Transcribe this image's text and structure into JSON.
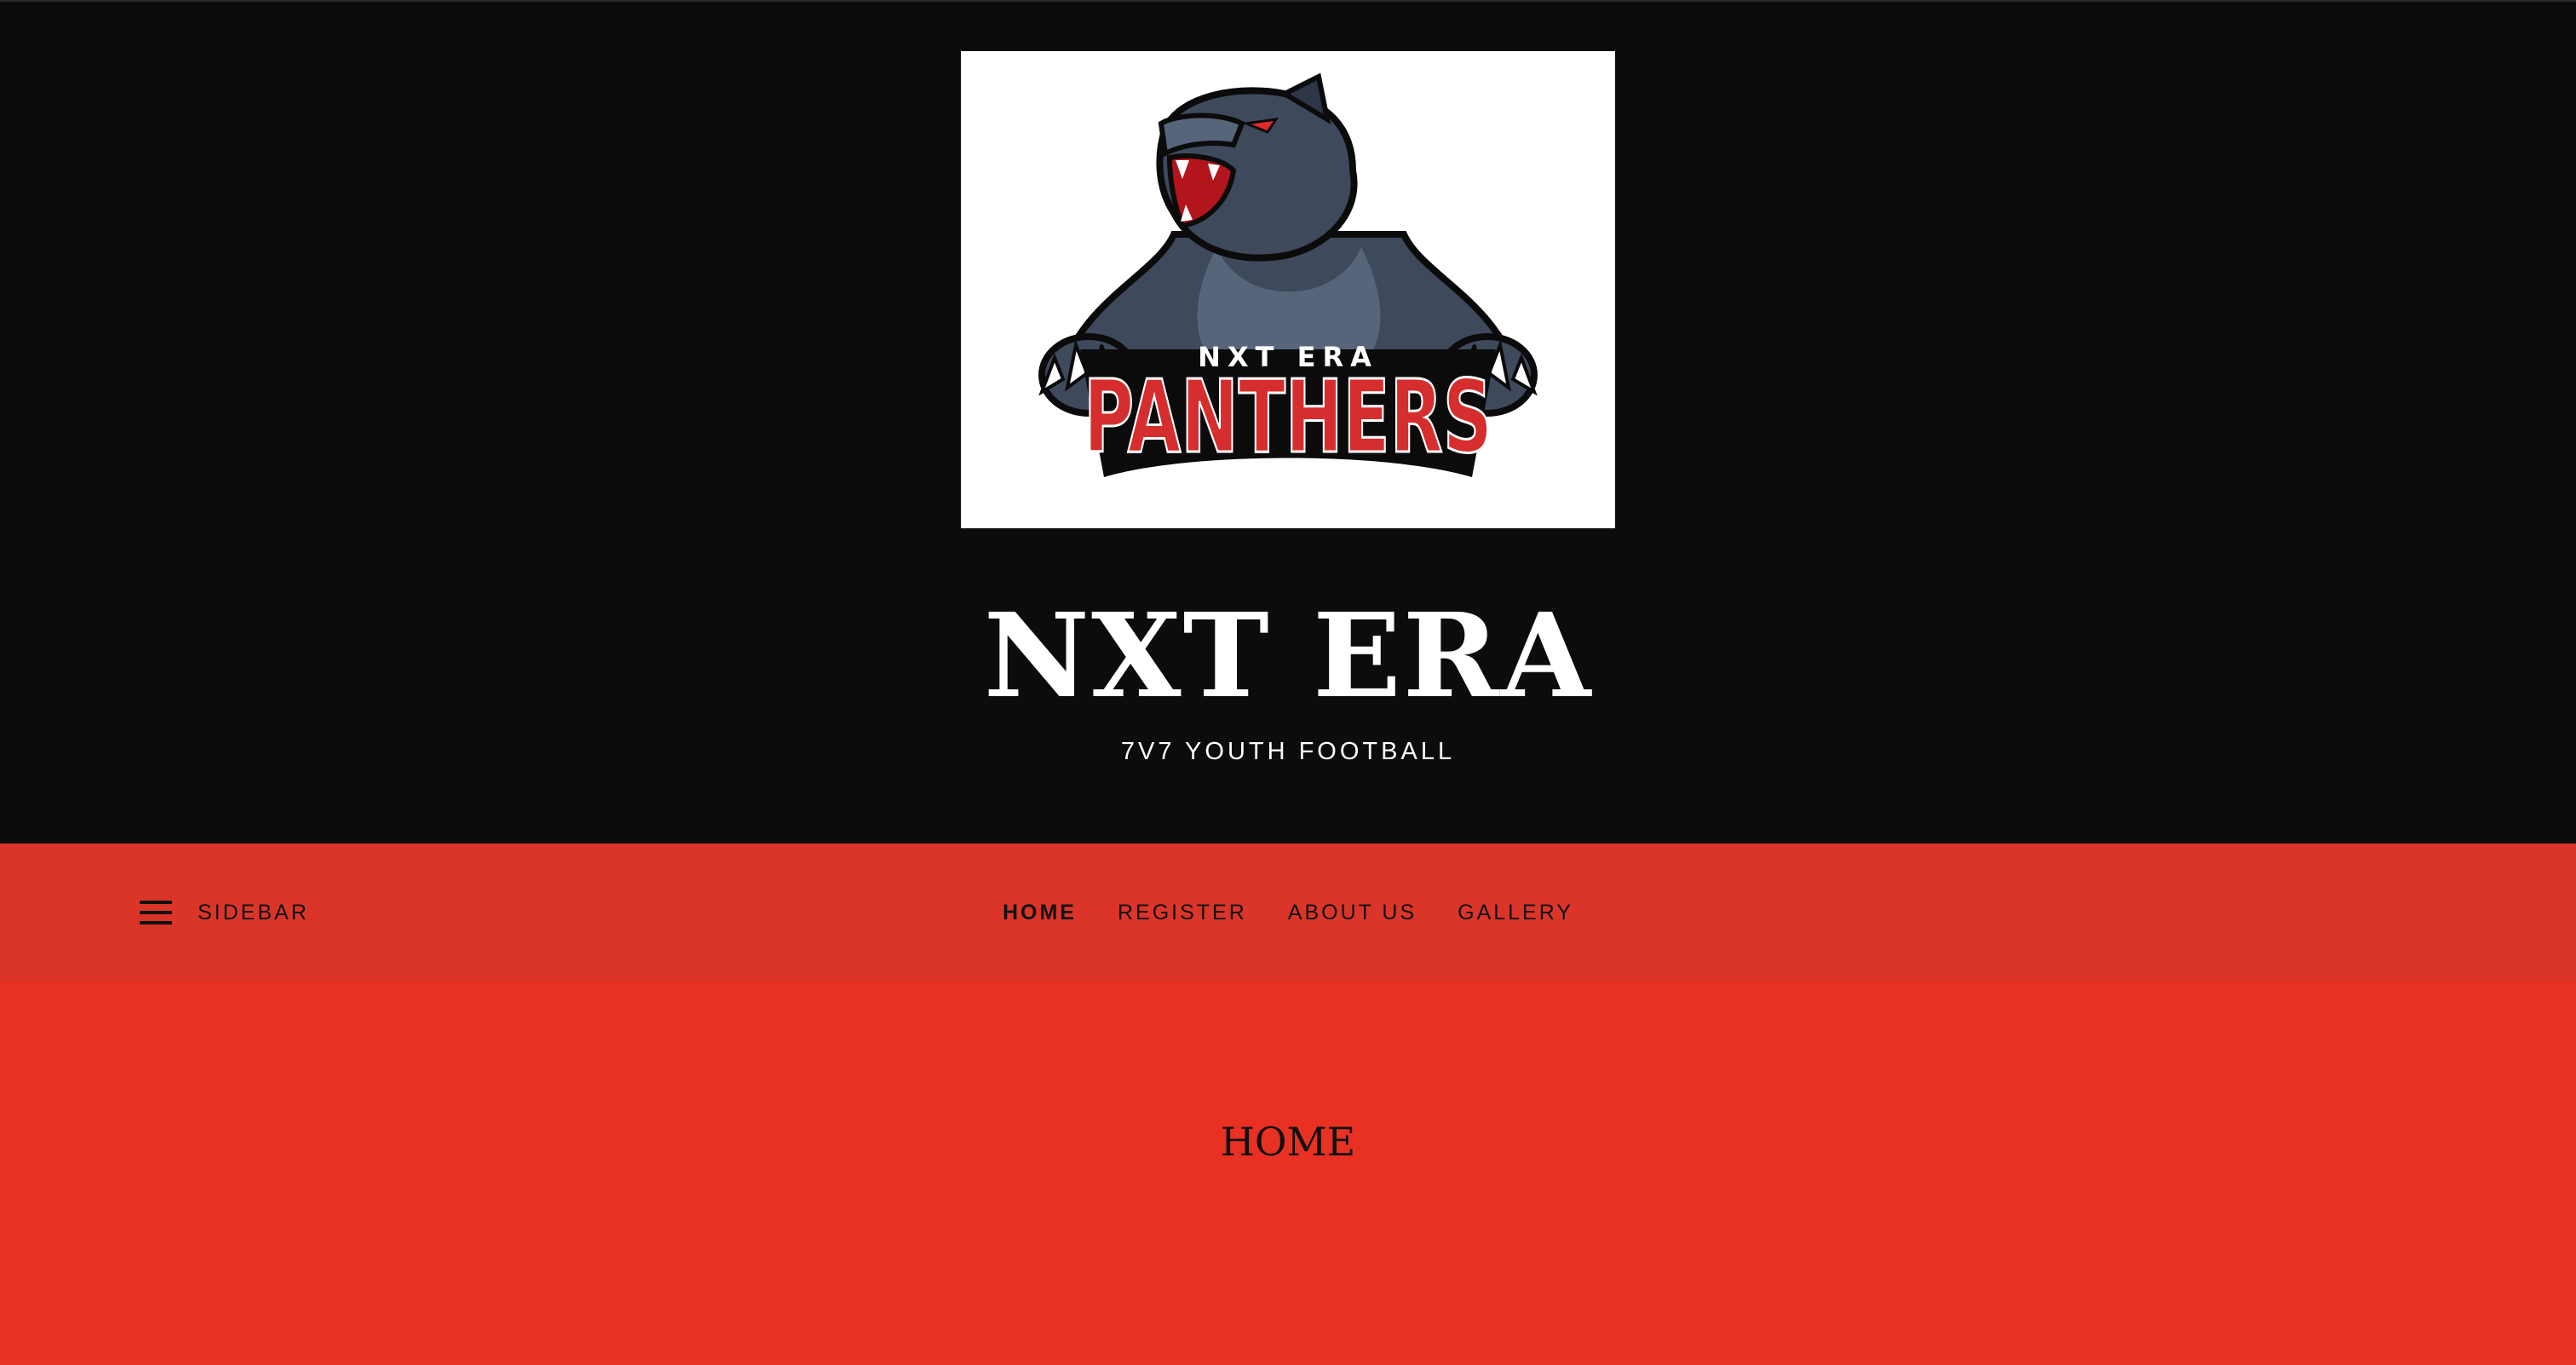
{
  "site": {
    "logo_alt": "NXT ERA Panthers logo",
    "logo_wordmark_top": "NXT ERA",
    "logo_wordmark_main": "PANTHERS",
    "title": "NXT ERA",
    "tagline": "7V7 YOUTH FOOTBALL"
  },
  "nav": {
    "sidebar_label": "SIDEBAR",
    "sidebar_icon": "menu-icon",
    "links": [
      {
        "label": "HOME",
        "active": true
      },
      {
        "label": "REGISTER",
        "active": false
      },
      {
        "label": "ABOUT US",
        "active": false
      },
      {
        "label": "GALLERY",
        "active": false
      }
    ]
  },
  "main": {
    "page_title": "HOME"
  },
  "colors": {
    "header_bg": "#0c0c0c",
    "nav_bg": "#db352a",
    "content_bg": "#e83123",
    "logo_red": "#d62e2e",
    "panther_slate": "#3e4a5c"
  }
}
